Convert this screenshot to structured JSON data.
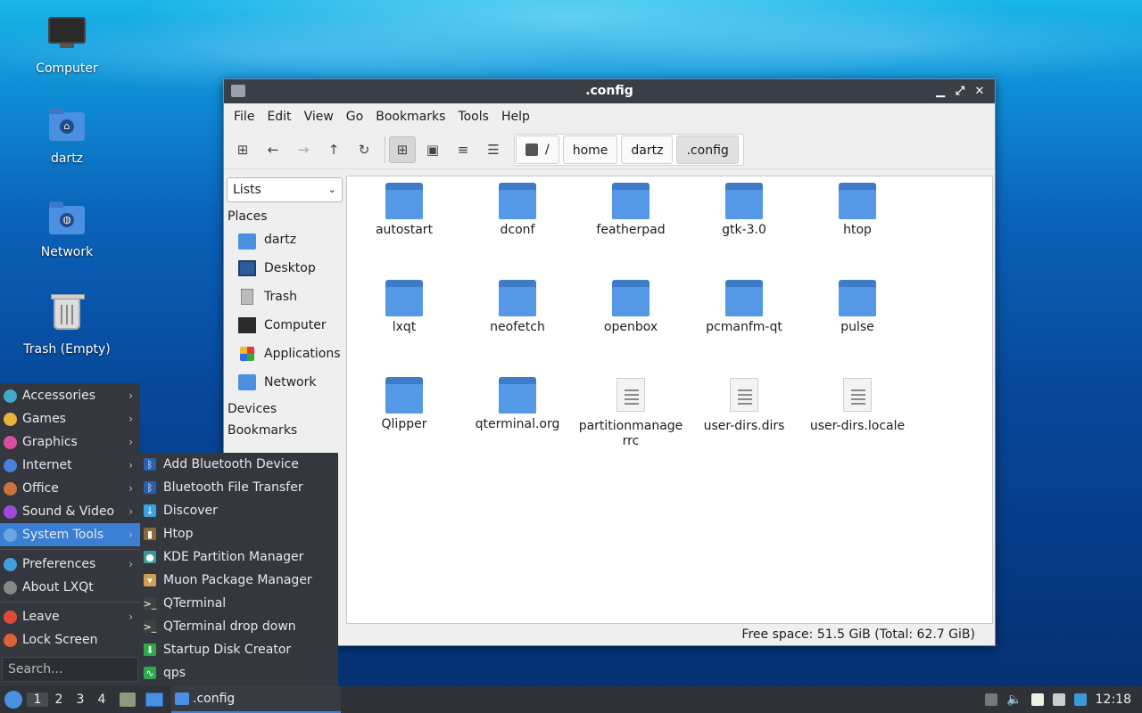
{
  "desktop": {
    "icons": [
      {
        "label": "Computer"
      },
      {
        "label": "dartz"
      },
      {
        "label": "Network"
      },
      {
        "label": "Trash (Empty)"
      }
    ]
  },
  "window": {
    "title": ".config",
    "controls": {
      "minimize": "▁",
      "maximize": "⤢",
      "close": "✕"
    },
    "menu": [
      "File",
      "Edit",
      "View",
      "Go",
      "Bookmarks",
      "Tools",
      "Help"
    ],
    "toolbar": {
      "new_tab": "⊞",
      "back": "←",
      "forward": "→",
      "up": "↑",
      "reload": "↻",
      "view_icon": "⊞",
      "view_thumb": "▣",
      "view_compact": "≡",
      "view_detail": "☰"
    },
    "path": {
      "root": "/",
      "crumbs": [
        "home",
        "dartz",
        ".config"
      ]
    },
    "sidebar": {
      "select": "Lists",
      "places_header": "Places",
      "places": [
        "dartz",
        "Desktop",
        "Trash",
        "Computer",
        "Applications",
        "Network"
      ],
      "devices_header": "Devices",
      "bookmarks_header": "Bookmarks"
    },
    "files": [
      {
        "name": "autostart",
        "type": "folder"
      },
      {
        "name": "dconf",
        "type": "folder"
      },
      {
        "name": "featherpad",
        "type": "folder"
      },
      {
        "name": "gtk-3.0",
        "type": "folder"
      },
      {
        "name": "htop",
        "type": "folder"
      },
      {
        "name": "lxqt",
        "type": "folder"
      },
      {
        "name": "neofetch",
        "type": "folder"
      },
      {
        "name": "openbox",
        "type": "folder"
      },
      {
        "name": "pcmanfm-qt",
        "type": "folder"
      },
      {
        "name": "pulse",
        "type": "folder"
      },
      {
        "name": "Qlipper",
        "type": "folder"
      },
      {
        "name": "qterminal.org",
        "type": "folder"
      },
      {
        "name": "partitionmanagerrc",
        "type": "file"
      },
      {
        "name": "user-dirs.dirs",
        "type": "file"
      },
      {
        "name": "user-dirs.locale",
        "type": "file"
      }
    ],
    "status": "Free space: 51.5 GiB (Total: 62.7 GiB)"
  },
  "appmenu": {
    "items": [
      {
        "label": "Accessories",
        "color": "#3fa9c9",
        "has_sub": true
      },
      {
        "label": "Games",
        "color": "#e8b43a",
        "has_sub": true
      },
      {
        "label": "Graphics",
        "color": "#d94fa0",
        "has_sub": true
      },
      {
        "label": "Internet",
        "color": "#4a7fe0",
        "has_sub": true
      },
      {
        "label": "Office",
        "color": "#c9733a",
        "has_sub": true
      },
      {
        "label": "Sound & Video",
        "color": "#a04ad9",
        "has_sub": true
      },
      {
        "label": "System Tools",
        "color": "#6aa6e0",
        "has_sub": true,
        "selected": true
      }
    ],
    "items2": [
      {
        "label": "Preferences",
        "color": "#3fa0e0",
        "has_sub": true
      },
      {
        "label": "About LXQt",
        "color": "#888888",
        "has_sub": false
      }
    ],
    "items3": [
      {
        "label": "Leave",
        "color": "#e04a3a",
        "has_sub": true
      },
      {
        "label": "Lock Screen",
        "color": "#e0603a",
        "has_sub": false
      }
    ],
    "search_placeholder": "Search..."
  },
  "submenu": {
    "items": [
      {
        "label": "Add Bluetooth Device",
        "icon": "ᛒ",
        "color": "#2a5fb0"
      },
      {
        "label": "Bluetooth File Transfer",
        "icon": "ᛒ",
        "color": "#2a5fb0"
      },
      {
        "label": "Discover",
        "icon": "↓",
        "color": "#3da0e0"
      },
      {
        "label": "Htop",
        "icon": "▮",
        "color": "#8a6a3a"
      },
      {
        "label": "KDE Partition Manager",
        "icon": "●",
        "color": "#3a9a9a"
      },
      {
        "label": "Muon Package Manager",
        "icon": "▾",
        "color": "#d0a050"
      },
      {
        "label": "QTerminal",
        "icon": ">_",
        "color": "#404040"
      },
      {
        "label": "QTerminal drop down",
        "icon": ">_",
        "color": "#404040"
      },
      {
        "label": "Startup Disk Creator",
        "icon": "⬇",
        "color": "#2ea84a"
      },
      {
        "label": "qps",
        "icon": "∿",
        "color": "#2ea84a"
      }
    ]
  },
  "taskbar": {
    "workspaces": [
      "1",
      "2",
      "3",
      "4"
    ],
    "task_label": ".config",
    "clock": "12:18",
    "tray_icons": [
      "up-arrow-icon",
      "volume-icon",
      "clipboard-icon",
      "network-icon",
      "updates-icon"
    ]
  }
}
